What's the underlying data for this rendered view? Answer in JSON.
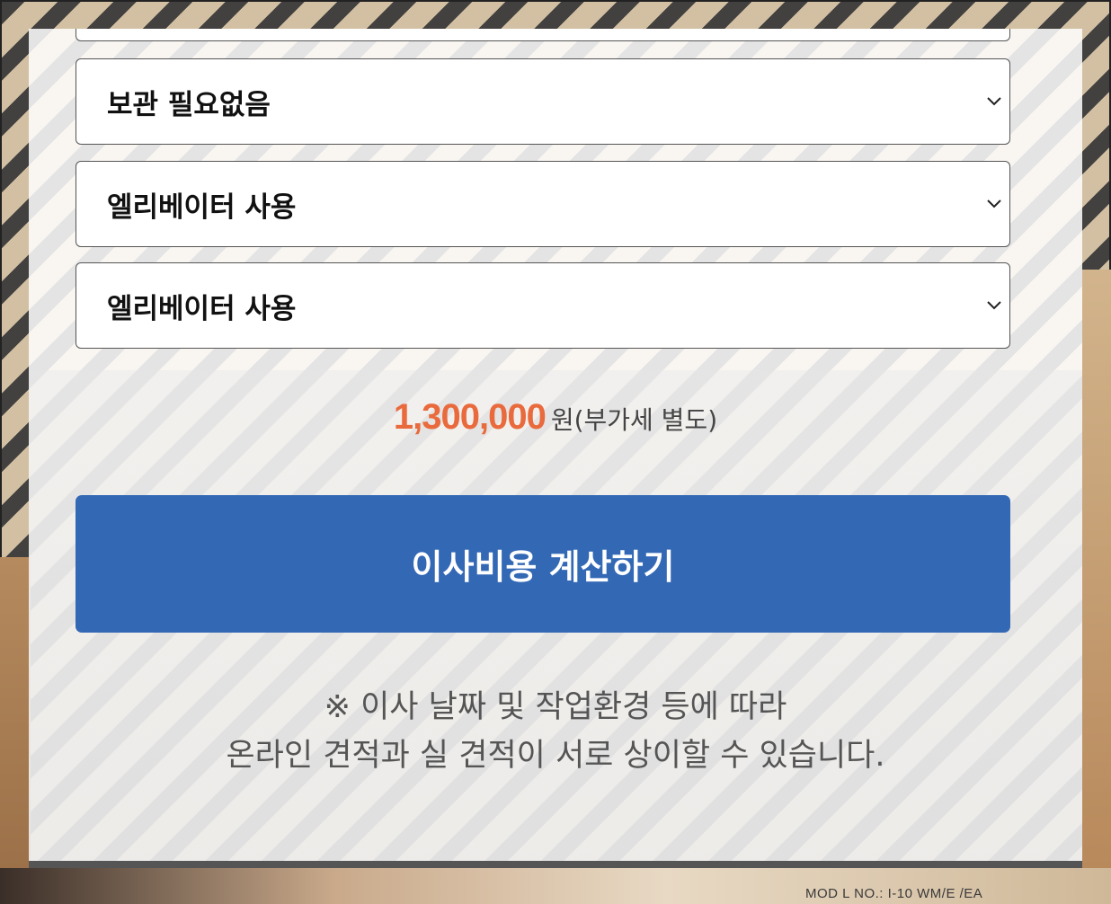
{
  "form": {
    "storage_select": {
      "value": "보관 필요없음"
    },
    "elevator_select_1": {
      "value": "엘리베이터 사용"
    },
    "elevator_select_2": {
      "value": "엘리베이터 사용"
    }
  },
  "price": {
    "amount": "1,300,000",
    "unit": "원(부가세 별도)"
  },
  "calculate_button": {
    "label": "이사비용 계산하기"
  },
  "notice": {
    "line1": "※ 이사 날짜 및 작업환경 등에 따라",
    "line2": "온라인 견적과 실 견적이 서로 상이할 수 있습니다."
  },
  "background": {
    "box_label": "MOD  L NO.: I-10 WM/E  /EA"
  },
  "colors": {
    "price": "#e96a3c",
    "button": "#3368b5"
  },
  "icons": {
    "select_arrow": "chevron-down-icon"
  }
}
